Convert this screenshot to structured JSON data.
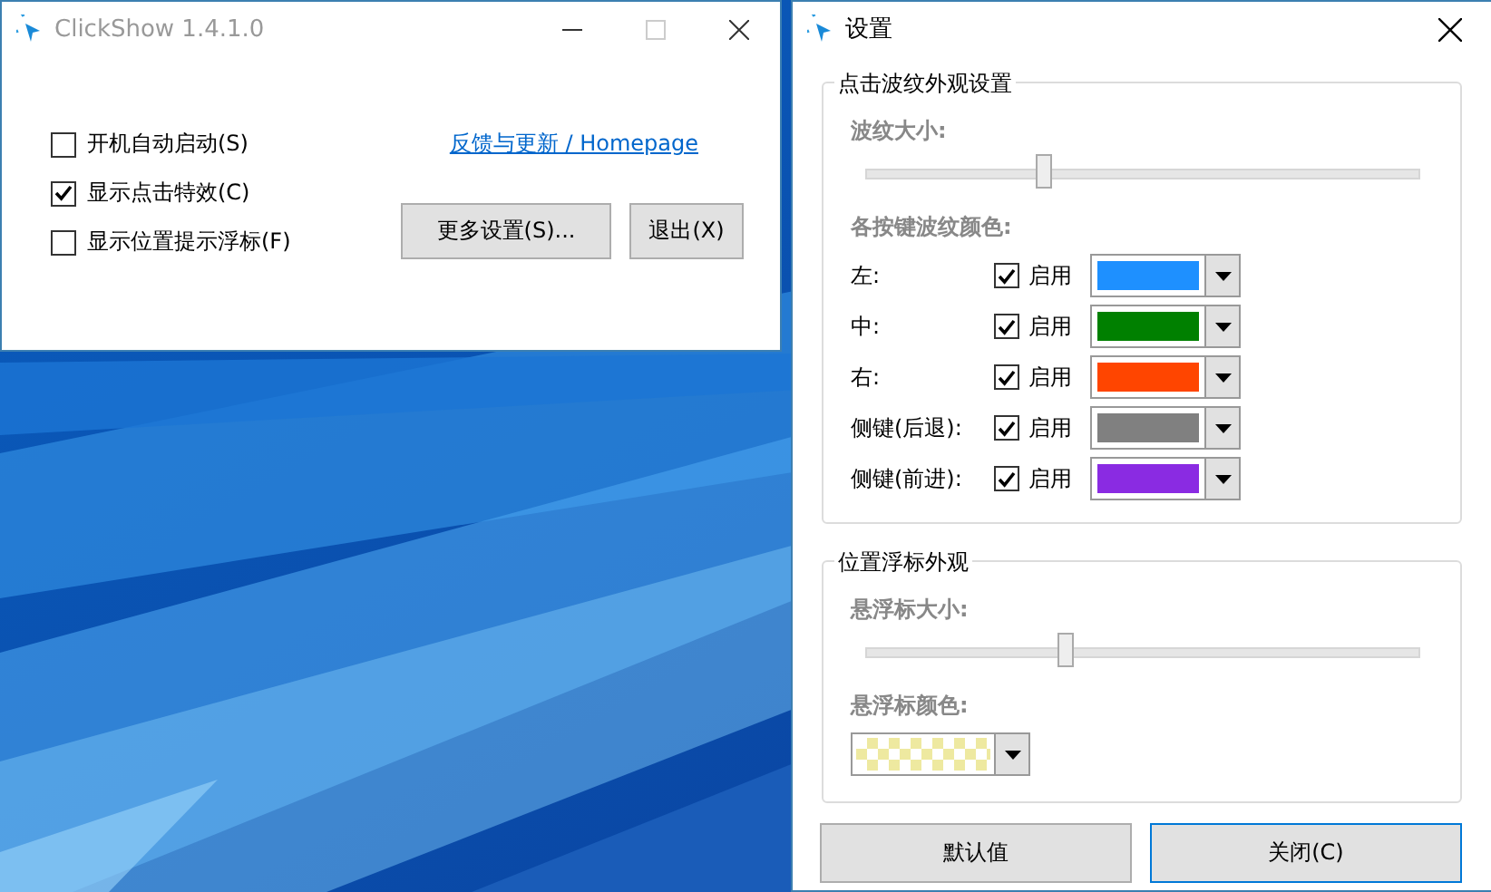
{
  "main_window": {
    "title": "ClickShow 1.4.1.0",
    "options": [
      {
        "label": "开机自动启动(S)",
        "checked": false
      },
      {
        "label": "显示点击特效(C)",
        "checked": true
      },
      {
        "label": "显示位置提示浮标(F)",
        "checked": false
      }
    ],
    "link": "反馈与更新 / Homepage",
    "buttons": [
      "更多设置(S)...",
      "退出(X)"
    ]
  },
  "settings_window": {
    "title": "设置",
    "ripple_group": {
      "legend": "点击波纹外观设置",
      "size_label": "波纹大小:",
      "size_slider": {
        "level": 0.32
      },
      "colors_label": "各按键波纹颜色:",
      "keys": [
        {
          "name": "左:",
          "checked": true,
          "enable_label": "启用",
          "color": "#1e90ff"
        },
        {
          "name": "中:",
          "checked": true,
          "enable_label": "启用",
          "color": "#008000"
        },
        {
          "name": "右:",
          "checked": true,
          "enable_label": "启用",
          "color": "#ff4500"
        },
        {
          "name": "侧键(后退):",
          "checked": true,
          "enable_label": "启用",
          "color": "#808080"
        },
        {
          "name": "侧键(前进):",
          "checked": true,
          "enable_label": "启用",
          "color": "#8a2be2"
        }
      ]
    },
    "marker_group": {
      "legend": "位置浮标外观",
      "size_label": "悬浮标大小:",
      "size_slider": {
        "level": 0.36
      },
      "color_label": "悬浮标颜色:",
      "color": "#eee9a0"
    },
    "buttons": [
      {
        "label": "默认值",
        "selected": false
      },
      {
        "label": "关闭(C)",
        "selected": true
      }
    ]
  }
}
